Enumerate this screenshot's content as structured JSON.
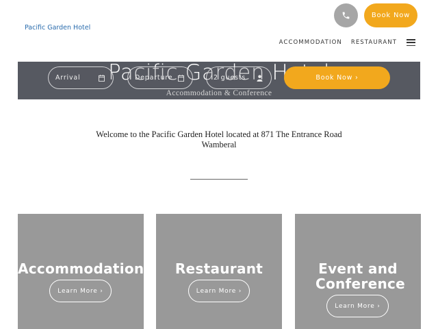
{
  "header": {
    "logo_text": "Pacific Garden Hotel",
    "book_now": "Book Now",
    "phone_icon": "phone-icon"
  },
  "nav": {
    "items": [
      "ACCOMMODATION",
      "RESTAURANT"
    ],
    "menu_icon": "hamburger-icon"
  },
  "hero": {
    "title": "Pacific Garden Hotel",
    "subtitle": "Accommodation & Conference"
  },
  "booking": {
    "arrival": "Arrival",
    "departure": "Departure",
    "guests": "2 guests",
    "book_now": "Book Now  ›",
    "calendar_icon": "calendar-icon",
    "guest_icon": "user-icon"
  },
  "welcome": {
    "line1": "Welcome to the Pacific Garden Hotel located at 871 The Entrance Road",
    "line2": "Wamberal"
  },
  "cards": [
    {
      "title": "Accommodation",
      "button": "Learn More  ›"
    },
    {
      "title": "Restaurant",
      "button": "Learn More  ›"
    },
    {
      "title": "Event and Conference",
      "button": "Learn More  ›"
    }
  ],
  "colors": {
    "accent": "#f2a81d",
    "hero_bg": "#565961",
    "card_bg": "#999999",
    "logo": "#2a6cad"
  }
}
